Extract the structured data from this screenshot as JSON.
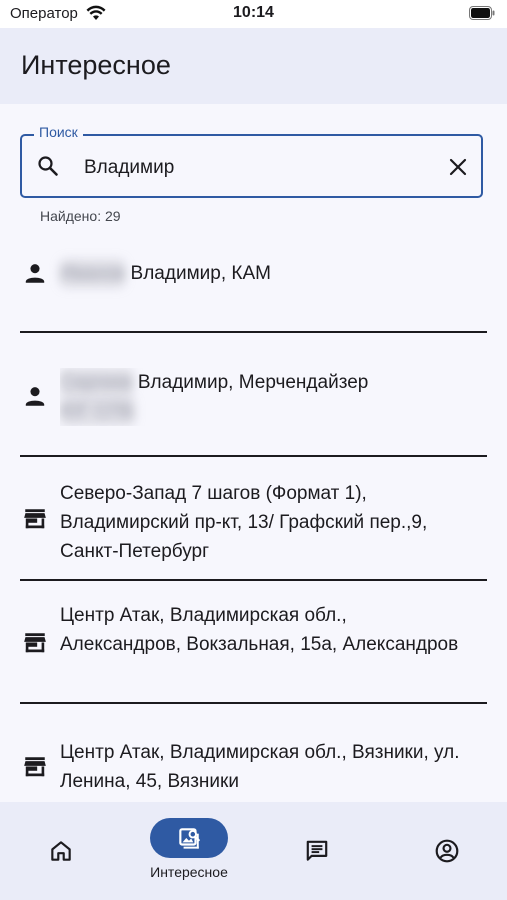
{
  "status_bar": {
    "carrier": "Оператор",
    "time": "10:14"
  },
  "header": {
    "title": "Интересное"
  },
  "search": {
    "label": "Поиск",
    "value": "Владимир",
    "found": "Найдено: 29"
  },
  "results": [
    {
      "type": "person",
      "blurred_prefix": "Иванов",
      "text": " Владимир, КАМ",
      "blurred_suffix": ""
    },
    {
      "type": "person",
      "blurred_prefix": "Сергеев",
      "text": " Владимир, Мерчендайзер",
      "blurred_suffix": "ЮГ СПБ"
    },
    {
      "type": "store",
      "text": "Северо-Запад 7 шагов (Формат 1), Владимирский пр-кт, 13/ Графский пер.,9, Санкт-Петербург"
    },
    {
      "type": "store",
      "text": "Центр Атак, Владимирская обл., Александров, Вокзальная, 15а, Александров"
    },
    {
      "type": "store",
      "text": "Центр Атак, Владимирская обл., Вязники, ул. Ленина, 45, Вязники"
    }
  ],
  "bottom_nav": {
    "items": [
      {
        "name": "home",
        "label": ""
      },
      {
        "name": "interesting",
        "label": "Интересное",
        "active": true
      },
      {
        "name": "messages",
        "label": ""
      },
      {
        "name": "profile",
        "label": ""
      }
    ]
  },
  "colors": {
    "accent": "#2f5aa3",
    "header_bg": "#eaecf8",
    "page_bg": "#f7f7fd",
    "text": "#1c1b1f"
  }
}
